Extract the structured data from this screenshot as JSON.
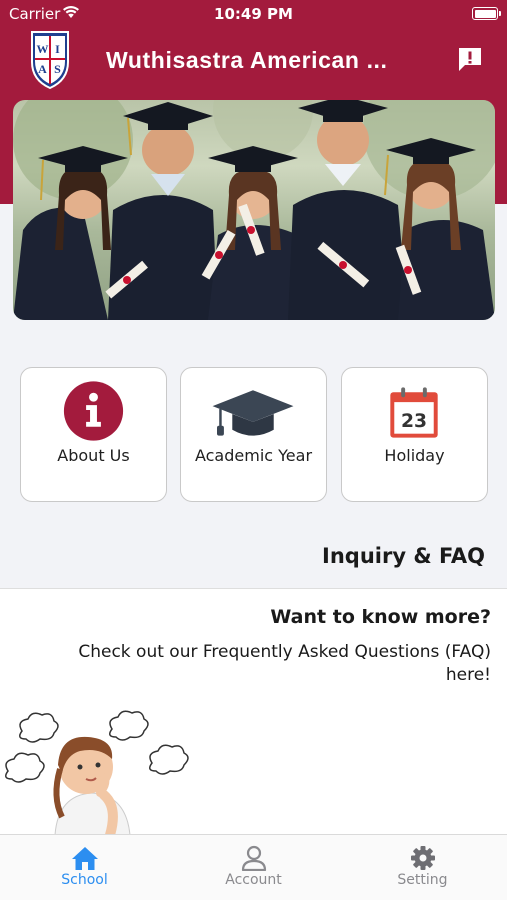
{
  "status_bar": {
    "carrier": "Carrier",
    "time": "10:49 PM"
  },
  "header": {
    "title": "Wuthisastra American ...",
    "logo_letters": [
      "W",
      "A",
      "I",
      "S"
    ],
    "feedback_icon": "feedback-exclamation-icon"
  },
  "banner": {
    "image": "graduates-photo"
  },
  "menu": {
    "tiles": [
      {
        "label": "About Us",
        "icon": "info-circle-icon"
      },
      {
        "label": "Academic Year",
        "icon": "graduation-cap-icon"
      },
      {
        "label": "Holiday",
        "icon": "calendar-icon",
        "icon_text": "23"
      }
    ]
  },
  "inquiry": {
    "title": "Inquiry & FAQ",
    "heading": "Want to know more?",
    "text": "Check out our Frequently Asked Questions (FAQ) here!"
  },
  "tab_bar": {
    "tabs": [
      {
        "label": "School",
        "icon": "home-icon",
        "active": true
      },
      {
        "label": "Account",
        "icon": "person-icon",
        "active": false
      },
      {
        "label": "Setting",
        "icon": "gear-icon",
        "active": false
      }
    ]
  },
  "colors": {
    "brand": "#a31b3d",
    "active_tab": "#2c8ef0",
    "inactive_tab": "#8a8a8e"
  }
}
